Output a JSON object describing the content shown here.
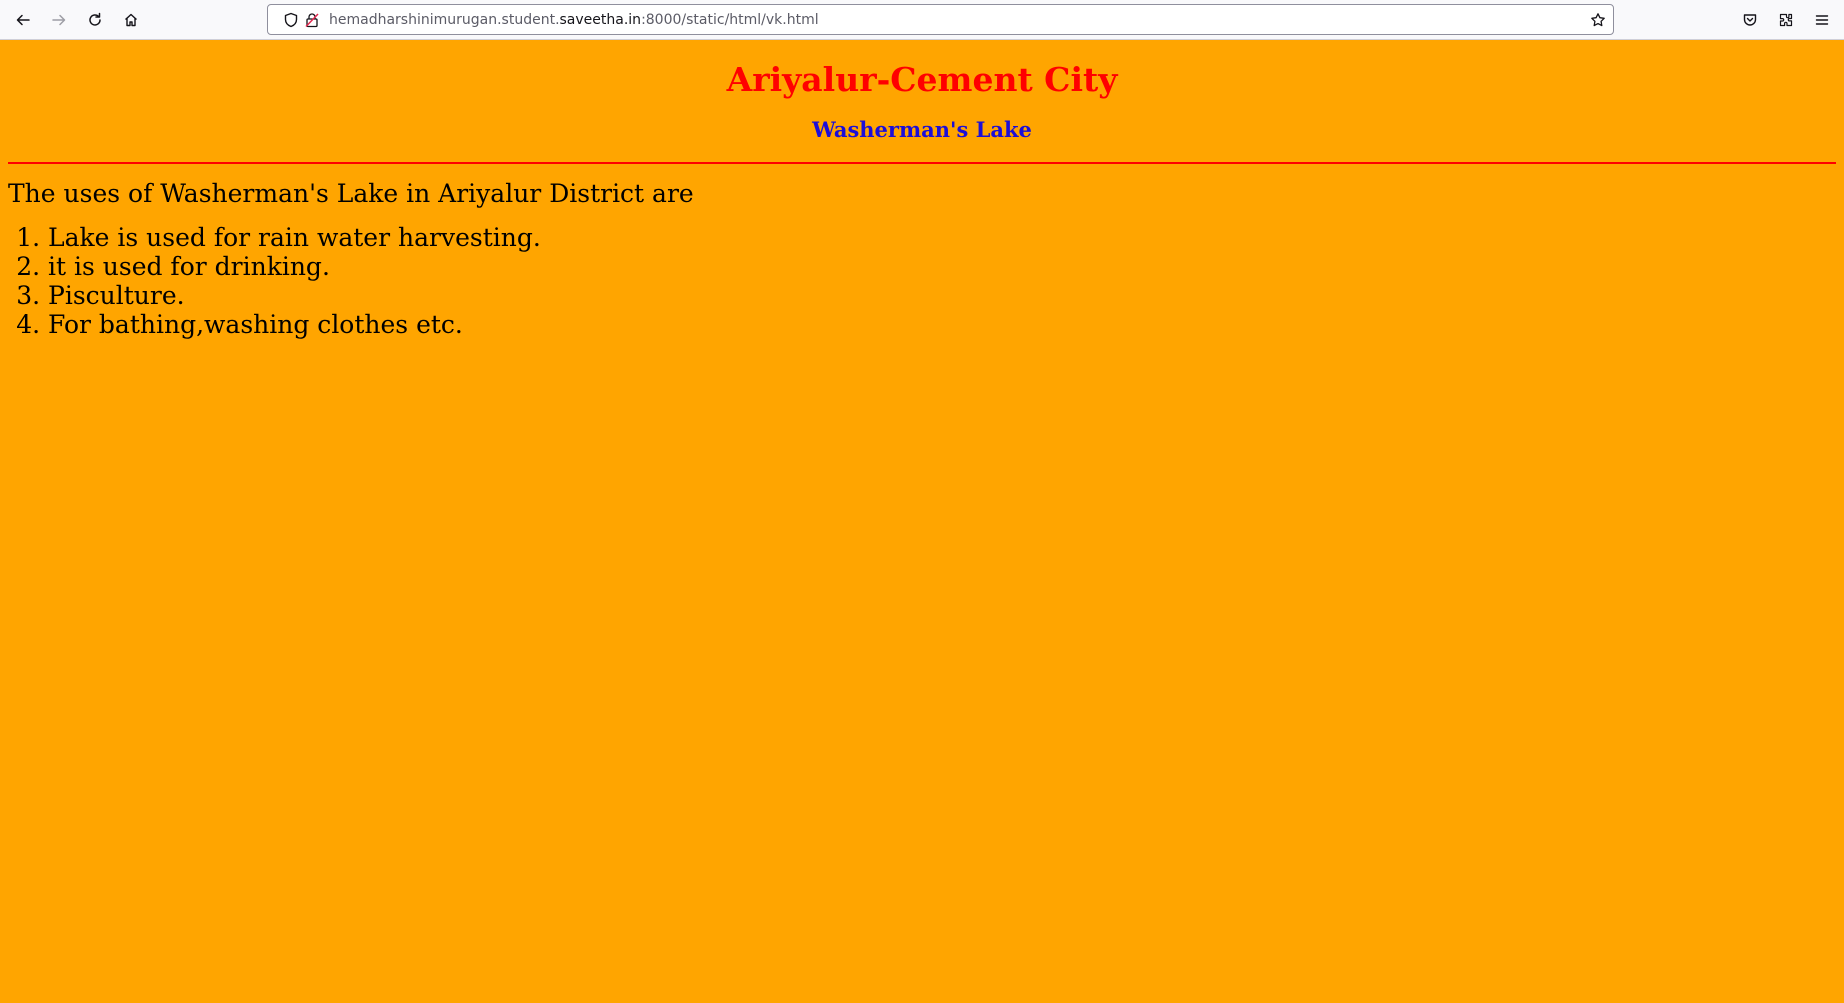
{
  "browser": {
    "url": {
      "prefix": "hemadharshinimurugan.student.",
      "domain": "saveetha.in",
      "suffix": ":8000/static/html/vk.html"
    },
    "icons": {
      "back": "back-arrow-icon",
      "forward": "forward-arrow-icon",
      "reload": "reload-icon",
      "home": "home-icon",
      "shield": "tracking-protection-shield-icon",
      "lock": "insecure-lock-icon",
      "bookmark": "bookmark-star-icon",
      "pocket": "pocket-icon",
      "extensions": "extensions-icon",
      "menu": "hamburger-menu-icon"
    }
  },
  "page": {
    "background": "#ffa500",
    "title": "Ariyalur-Cement City",
    "title_color": "#ff0000",
    "subtitle": "Washerman's Lake",
    "subtitle_color": "#1c0ed8",
    "rule_color": "#ff0000",
    "intro": "The uses of Washerman's Lake in Ariyalur District are",
    "uses": [
      "Lake is used for rain water harvesting.",
      "it is used for drinking.",
      "Pisculture.",
      "For bathing,washing clothes etc."
    ]
  }
}
